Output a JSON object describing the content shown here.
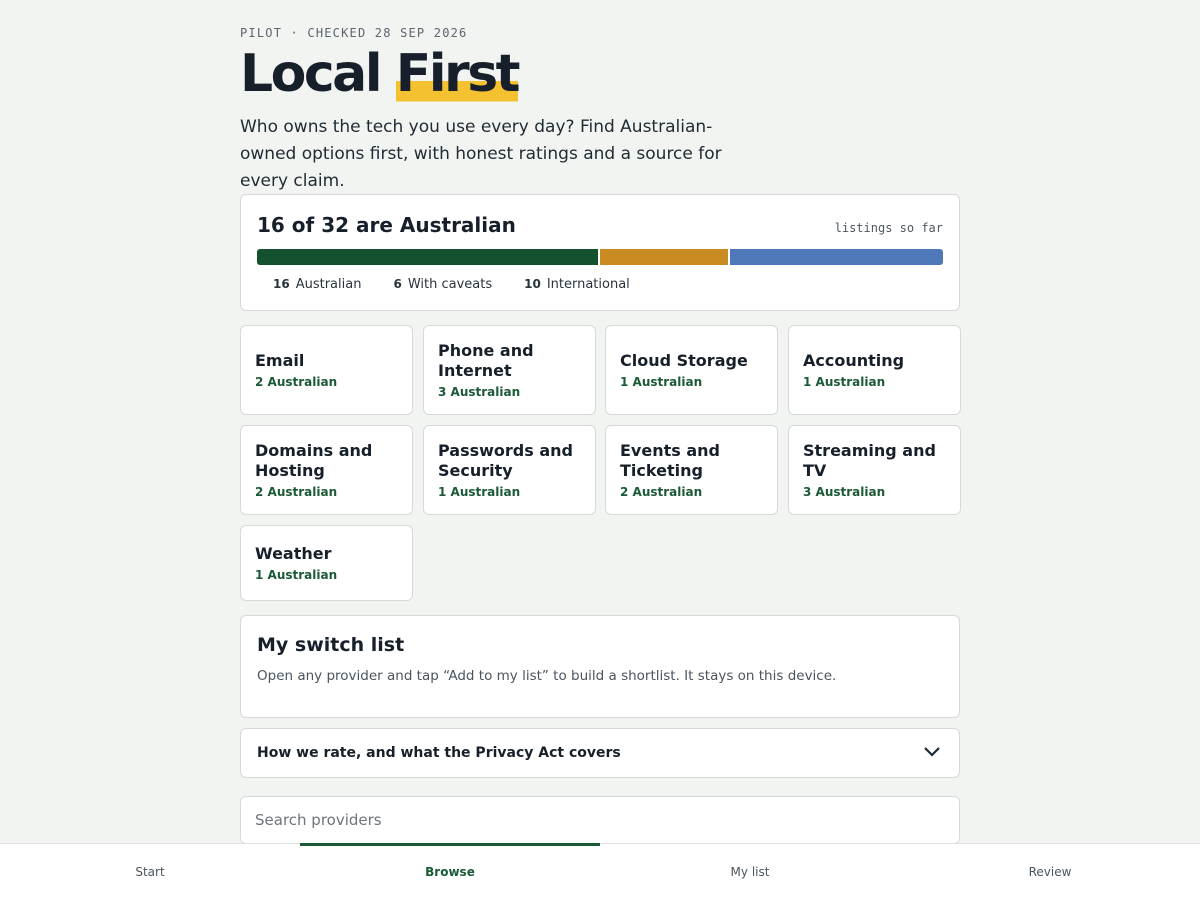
{
  "header": {
    "eyebrow": "PILOT · CHECKED 28 SEP 2026",
    "title_plain": "Local ",
    "title_highlight": "First",
    "lede": "Who owns the tech you use every day? Find Australian-owned options first, with honest ratings and a source for every claim."
  },
  "summary": {
    "title": "16 of 32 are Australian",
    "note": "listings so far",
    "segments": [
      {
        "count": "16",
        "label": "Australian",
        "value": 16,
        "color": "#14522f"
      },
      {
        "count": "6",
        "label": "With caveats",
        "value": 6,
        "color": "#c98a22"
      },
      {
        "count": "10",
        "label": "International",
        "value": 10,
        "color": "#4f78b8"
      }
    ]
  },
  "categories": [
    {
      "name": "Email",
      "count": "2 Australian"
    },
    {
      "name": "Phone and Internet",
      "count": "3 Australian"
    },
    {
      "name": "Cloud Storage",
      "count": "1 Australian"
    },
    {
      "name": "Accounting",
      "count": "1 Australian"
    },
    {
      "name": "Domains and Hosting",
      "count": "2 Australian"
    },
    {
      "name": "Passwords and Security",
      "count": "1 Australian"
    },
    {
      "name": "Events and Ticketing",
      "count": "2 Australian"
    },
    {
      "name": "Streaming and TV",
      "count": "3 Australian"
    },
    {
      "name": "Weather",
      "count": "1 Australian"
    }
  ],
  "switch_list": {
    "title": "My switch list",
    "body": "Open any provider and tap “Add to my list” to build a shortlist. It stays on this device."
  },
  "disclosure": {
    "label": "How we rate, and what the Privacy Act covers",
    "icon": "chevron-down-icon"
  },
  "search": {
    "placeholder": "Search providers",
    "value": ""
  },
  "tabs": [
    {
      "label": "Start",
      "active": false
    },
    {
      "label": "Browse",
      "active": true
    },
    {
      "label": "My list",
      "active": false
    },
    {
      "label": "Review",
      "active": false
    }
  ]
}
